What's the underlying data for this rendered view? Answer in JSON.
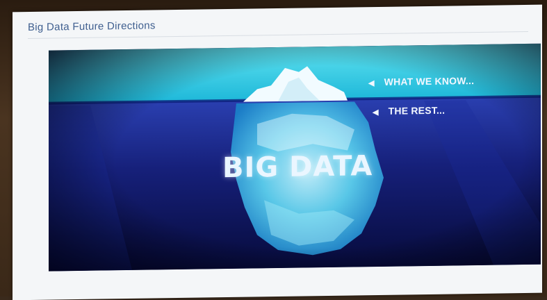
{
  "slide": {
    "title": "Big Data Future Directions"
  },
  "iceberg": {
    "label_above": "WHAT WE KNOW...",
    "label_below": "THE REST...",
    "center_text": "BIG DATA"
  },
  "colors": {
    "title": "#3f5f8f",
    "deep_water": "#050a3a",
    "surface_water": "#2ec9e6"
  },
  "icons": {
    "arrow": "left-arrow-icon"
  }
}
